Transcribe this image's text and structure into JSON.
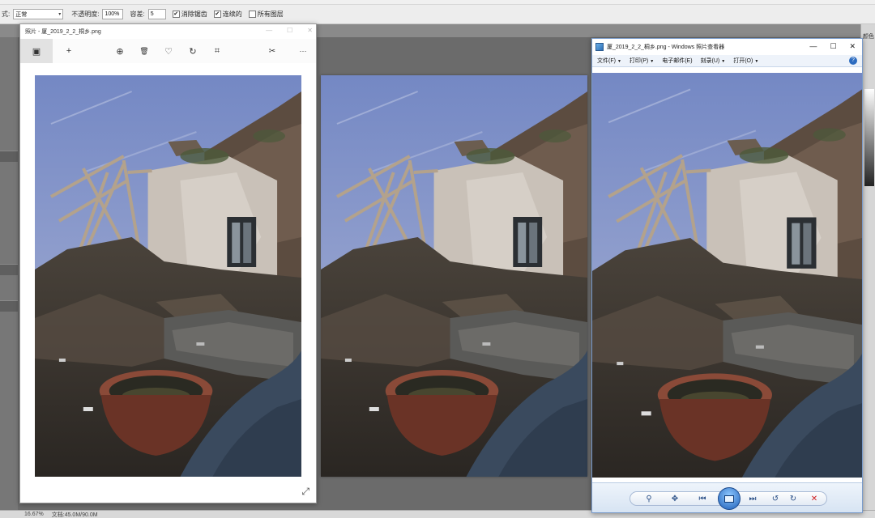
{
  "photoshop": {
    "options_bar": {
      "mode_label": "式:",
      "mode_value": "正常",
      "opacity_label": "不透明度:",
      "opacity_value": "100%",
      "tolerance_label": "容差:",
      "tolerance_value": "5",
      "antialias_label": "消除锯齿",
      "antialias_checked": true,
      "contiguous_label": "连续的",
      "contiguous_checked": true,
      "all_layers_label": "所有图层",
      "all_layers_checked": false
    },
    "right_panel_tab": "颜色",
    "status": {
      "zoom": "16.67%",
      "doc_info": "文档:45.0M/90.0M"
    }
  },
  "photos_app": {
    "title": "照片 - 厦_2019_2_2_桐乡.png",
    "toolbar": [
      {
        "name": "save-icon",
        "glyph": "▣"
      },
      {
        "name": "add-icon",
        "glyph": "+"
      },
      {
        "name": "zoom-icon",
        "glyph": "⊕"
      },
      {
        "name": "delete-icon",
        "glyph": "🗑"
      },
      {
        "name": "favorite-icon",
        "glyph": "♡"
      },
      {
        "name": "rotate-icon",
        "glyph": "↻"
      },
      {
        "name": "crop-icon",
        "glyph": "⌗"
      },
      {
        "name": "edit-create-icon",
        "glyph": "✂"
      },
      {
        "name": "more-icon",
        "glyph": "···"
      }
    ]
  },
  "photo_viewer": {
    "title": "厦_2019_2_2_桐乡.png - Windows 照片查看器",
    "menus": [
      {
        "label": "文件(F)"
      },
      {
        "label": "打印(P)"
      },
      {
        "label": "电子邮件(E)"
      },
      {
        "label": "刻录(U)"
      },
      {
        "label": "打开(O)"
      }
    ],
    "help_glyph": "?",
    "window_buttons": [
      "—",
      "☐",
      "✕"
    ]
  },
  "colors": {
    "sky_top": "#7d93c9",
    "sky_bottom": "#a9b3d8",
    "wall": "#c9c1b8",
    "rubble": "#3b352f",
    "pot": "#8a4a38",
    "tarp": "#3a4a5e",
    "viewer_accent": "#2d6cc0"
  }
}
